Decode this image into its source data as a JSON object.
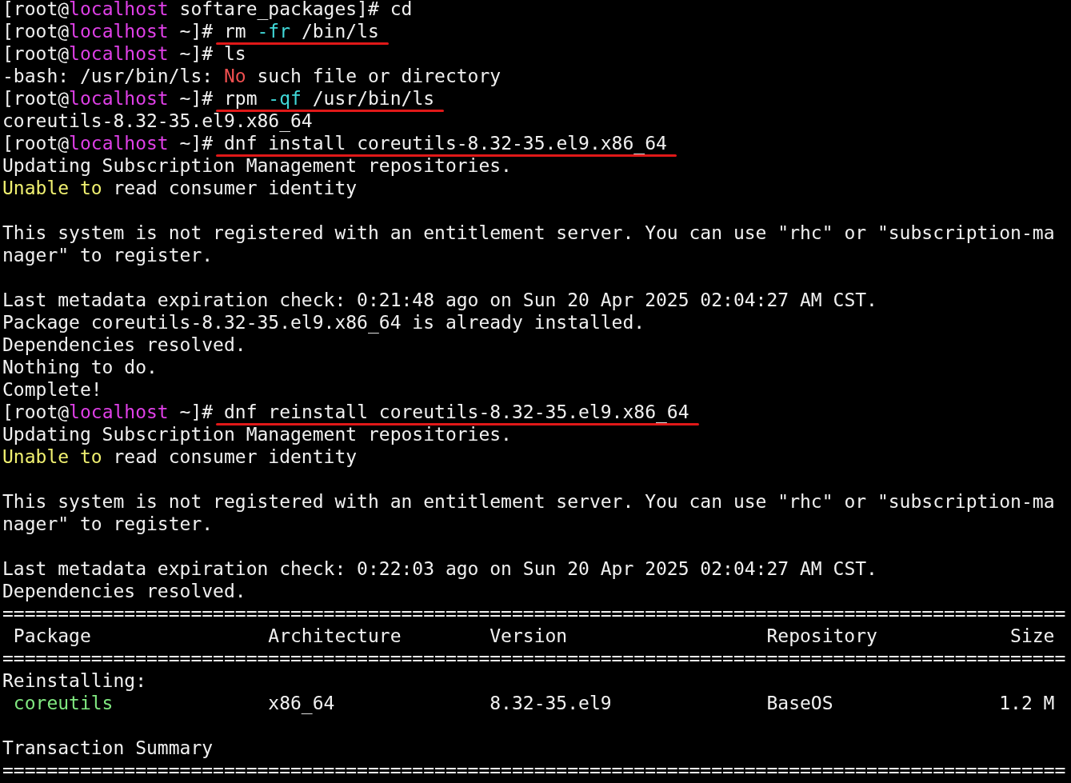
{
  "terminal": {
    "lines": [
      {
        "kind": "prompt",
        "prompt": [
          {
            "text": "[root@"
          },
          {
            "text": "localhost",
            "color": "#e040e8"
          },
          {
            "text": " softare_packages]# "
          }
        ],
        "command": [
          {
            "text": "cd"
          }
        ],
        "underlined": false
      },
      {
        "kind": "prompt",
        "prompt": [
          {
            "text": "[root@"
          },
          {
            "text": "localhost",
            "color": "#e040e8"
          },
          {
            "text": " ~]# "
          }
        ],
        "command": [
          {
            "text": "rm "
          },
          {
            "text": "-fr",
            "color": "#40d8d8"
          },
          {
            "text": " /bin/ls"
          }
        ],
        "underlined": true
      },
      {
        "kind": "prompt",
        "prompt": [
          {
            "text": "[root@"
          },
          {
            "text": "localhost",
            "color": "#e040e8"
          },
          {
            "text": " ~]# "
          }
        ],
        "command": [
          {
            "text": "ls"
          }
        ],
        "underlined": false
      },
      {
        "kind": "output",
        "segments": [
          {
            "text": "-bash: /usr/bin/ls: "
          },
          {
            "text": "No",
            "color": "#f05050"
          },
          {
            "text": " such file or directory"
          }
        ]
      },
      {
        "kind": "prompt",
        "prompt": [
          {
            "text": "[root@"
          },
          {
            "text": "localhost",
            "color": "#e040e8"
          },
          {
            "text": " ~]# "
          }
        ],
        "command": [
          {
            "text": "rpm "
          },
          {
            "text": "-qf",
            "color": "#40d8d8"
          },
          {
            "text": " /usr/bin/ls"
          }
        ],
        "underlined": true
      },
      {
        "kind": "output",
        "segments": [
          {
            "text": "coreutils-8.32-35.el9.x86_64"
          }
        ]
      },
      {
        "kind": "prompt",
        "prompt": [
          {
            "text": "[root@"
          },
          {
            "text": "localhost",
            "color": "#e040e8"
          },
          {
            "text": " ~]# "
          }
        ],
        "command": [
          {
            "text": "dnf install coreutils-8.32-35.el9.x86_64"
          }
        ],
        "underlined": true
      },
      {
        "kind": "output",
        "segments": [
          {
            "text": "Updating Subscription Management repositories."
          }
        ]
      },
      {
        "kind": "output",
        "segments": [
          {
            "text": "Unable to",
            "color": "#f0f070"
          },
          {
            "text": " read consumer identity"
          }
        ]
      },
      {
        "kind": "blank"
      },
      {
        "kind": "output",
        "segments": [
          {
            "text": "This system is not registered with an entitlement server. You can use \"rhc\" or \"subscription-ma"
          }
        ]
      },
      {
        "kind": "output",
        "segments": [
          {
            "text": "nager\" to register."
          }
        ]
      },
      {
        "kind": "blank"
      },
      {
        "kind": "output",
        "segments": [
          {
            "text": "Last metadata expiration check: 0:21:48 ago on Sun 20 Apr 2025 02:04:27 AM CST."
          }
        ]
      },
      {
        "kind": "output",
        "segments": [
          {
            "text": "Package coreutils-8.32-35.el9.x86_64 is already installed."
          }
        ]
      },
      {
        "kind": "output",
        "segments": [
          {
            "text": "Dependencies resolved."
          }
        ]
      },
      {
        "kind": "output",
        "segments": [
          {
            "text": "Nothing to do."
          }
        ]
      },
      {
        "kind": "output",
        "segments": [
          {
            "text": "Complete!"
          }
        ]
      },
      {
        "kind": "prompt",
        "prompt": [
          {
            "text": "[root@"
          },
          {
            "text": "localhost",
            "color": "#e040e8"
          },
          {
            "text": " ~]# "
          }
        ],
        "command": [
          {
            "text": "dnf reinstall coreutils-8.32-35.el9.x86_64"
          }
        ],
        "underlined": true
      },
      {
        "kind": "output",
        "segments": [
          {
            "text": "Updating Subscription Management repositories."
          }
        ]
      },
      {
        "kind": "output",
        "segments": [
          {
            "text": "Unable to",
            "color": "#f0f070"
          },
          {
            "text": " read consumer identity"
          }
        ]
      },
      {
        "kind": "blank"
      },
      {
        "kind": "output",
        "segments": [
          {
            "text": "This system is not registered with an entitlement server. You can use \"rhc\" or \"subscription-ma"
          }
        ]
      },
      {
        "kind": "output",
        "segments": [
          {
            "text": "nager\" to register."
          }
        ]
      },
      {
        "kind": "blank"
      },
      {
        "kind": "output",
        "segments": [
          {
            "text": "Last metadata expiration check: 0:22:03 ago on Sun 20 Apr 2025 02:04:27 AM CST."
          }
        ]
      },
      {
        "kind": "output",
        "segments": [
          {
            "text": "Dependencies resolved."
          }
        ]
      },
      {
        "kind": "rule",
        "text": "================================================================================================"
      },
      {
        "kind": "table",
        "cells": [
          {
            "text": "Package"
          },
          {
            "text": "Architecture"
          },
          {
            "text": "Version"
          },
          {
            "text": "Repository"
          },
          {
            "text": "Size"
          }
        ]
      },
      {
        "kind": "rule",
        "text": "================================================================================================"
      },
      {
        "kind": "output",
        "segments": [
          {
            "text": "Reinstalling:"
          }
        ]
      },
      {
        "kind": "table",
        "cells": [
          {
            "text": "coreutils",
            "color": "#80e880"
          },
          {
            "text": "x86_64"
          },
          {
            "text": "8.32-35.el9"
          },
          {
            "text": "BaseOS"
          },
          {
            "text": "1.2 M"
          }
        ]
      },
      {
        "kind": "blank"
      },
      {
        "kind": "output",
        "segments": [
          {
            "text": "Transaction Summary"
          }
        ]
      },
      {
        "kind": "rule",
        "text": "================================================================================================"
      }
    ]
  }
}
